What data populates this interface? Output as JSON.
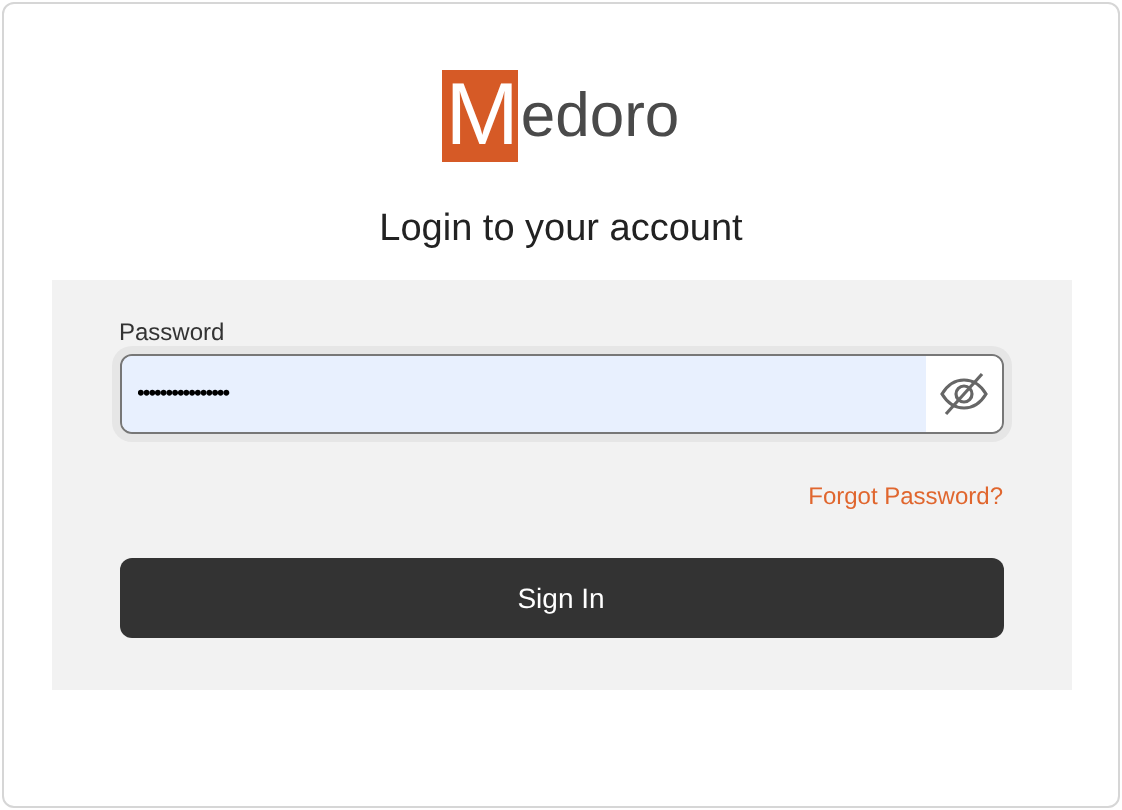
{
  "logo": {
    "mark": "M",
    "text": "edoro"
  },
  "heading": "Login to your account",
  "password": {
    "label": "Password",
    "value": "••••••••••••••••",
    "focused": true
  },
  "forgot_link": "Forgot Password?",
  "submit_button": "Sign In"
}
